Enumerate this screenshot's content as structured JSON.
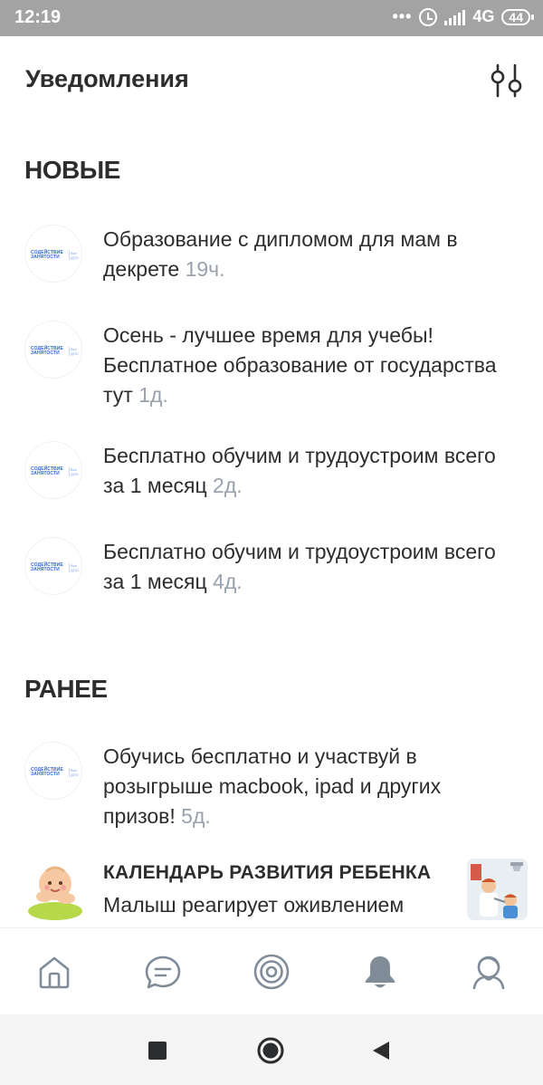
{
  "status_bar": {
    "time": "12:19",
    "dots": "•••",
    "network": "4G",
    "network_sub": "ıl",
    "battery": "44"
  },
  "header": {
    "title": "Уведомления"
  },
  "sections": {
    "new_title": "НОВЫЕ",
    "earlier_title": "РАНЕЕ"
  },
  "avatar_brand": {
    "line1": "СОДЕЙСТВИЕ",
    "line2": "ЗАНЯТОСТИ",
    "side1": "Все",
    "side2": "ДПО"
  },
  "notifications_new": [
    {
      "text": "Образование с дипломом для мам в декрете",
      "time": "19ч."
    },
    {
      "text": "Осень - лучшее время для учебы! Бесплатное образование от государства тут",
      "time": "1д."
    },
    {
      "text": "Бесплатно обучим и трудоустроим всего за 1 месяц",
      "time": "2д."
    },
    {
      "text": "Бесплатно обучим и трудоустроим всего за 1 месяц",
      "time": "4д."
    }
  ],
  "notifications_earlier": [
    {
      "text": "Обучись бесплатно и участвуй в розыгрыше macbook, ipad и других призов!",
      "time": "5д."
    }
  ],
  "calendar_item": {
    "heading": "КАЛЕНДАРЬ РАЗВИТИЯ РЕБЕНКА",
    "text": "Малыш реагирует оживлением"
  },
  "tabbar": {
    "items": [
      {
        "icon": "home-icon"
      },
      {
        "icon": "messages-icon"
      },
      {
        "icon": "discover-icon"
      },
      {
        "icon": "notifications-bell-icon"
      },
      {
        "icon": "profile-icon"
      }
    ]
  },
  "colors": {
    "status_bar_bg": "#a3a3a3",
    "text_primary": "#2c2d2e",
    "text_secondary": "#99a2ad",
    "icon_gray": "#818c99",
    "brand_blue": "#3168d6"
  }
}
